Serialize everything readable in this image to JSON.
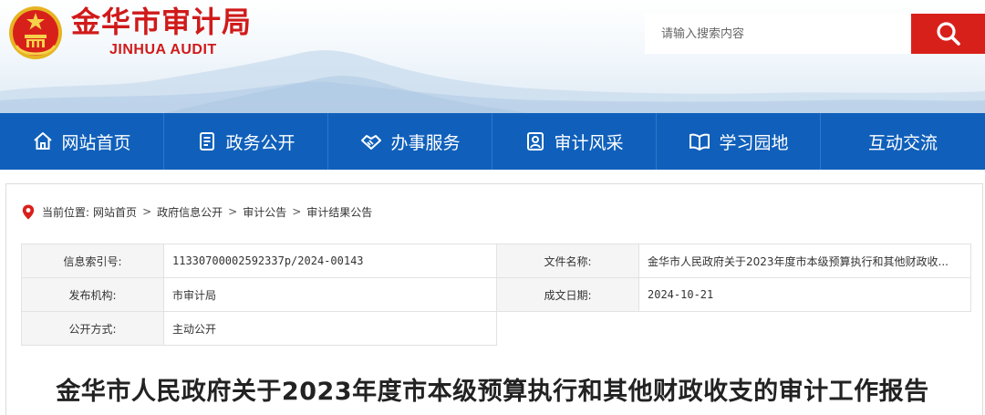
{
  "header": {
    "site_title": "金华市审计局",
    "site_subtitle": "JINHUA AUDIT",
    "search_placeholder": "请输入搜索内容"
  },
  "nav": {
    "items": [
      {
        "label": "网站首页",
        "icon": "home-icon"
      },
      {
        "label": "政务公开",
        "icon": "document-icon"
      },
      {
        "label": "办事服务",
        "icon": "handshake-icon"
      },
      {
        "label": "审计风采",
        "icon": "portrait-icon"
      },
      {
        "label": "学习园地",
        "icon": "book-icon"
      },
      {
        "label": "互动交流",
        "icon": ""
      }
    ]
  },
  "breadcrumb": {
    "label": "当前位置:",
    "items": [
      "网站首页",
      "政府信息公开",
      "审计公告",
      "审计结果公告"
    ]
  },
  "meta": {
    "index_label": "信息索引号:",
    "index_value": "11330700002592337p/2024-00143",
    "file_label": "文件名称:",
    "file_value": "金华市人民政府关于2023年度市本级预算执行和其他财政收...",
    "org_label": "发布机构:",
    "org_value": "市审计局",
    "date_label": "成文日期:",
    "date_value": "2024-10-21",
    "mode_label": "公开方式:",
    "mode_value": "主动公开"
  },
  "article": {
    "title": "金华市人民政府关于2023年度市本级预算执行和其他财政收支的审计工作报告"
  },
  "colors": {
    "brand_red": "#d01a1a",
    "nav_blue": "#1060bb",
    "search_red": "#d8201b"
  }
}
